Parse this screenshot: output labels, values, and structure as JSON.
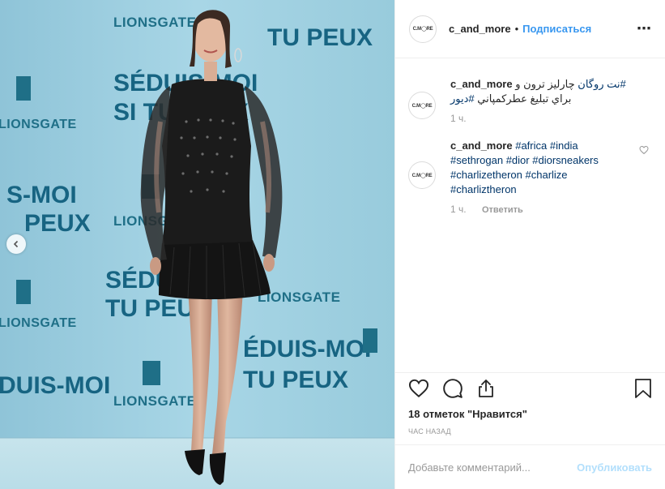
{
  "photo": {
    "wall_logos": [
      "LIONSGATE",
      "LIONSGATE",
      "LIONSGATE",
      "LIONSGATE",
      "LIONSGATE",
      "LIONSGATE"
    ],
    "wall_slogans": [
      "SÉDUIS-MOI",
      "SI TU PEUX",
      "TU PEUX",
      "S-MOI",
      "PEUX",
      "SÉDUIS-",
      "TU PEUX",
      "ÉDUIS-MOI",
      "TU PEUX",
      "DUIS-MOI"
    ],
    "colors": {
      "wall": "#9ecfe0",
      "print": "#176482",
      "dress": "#141414"
    }
  },
  "header": {
    "avatar_text": "C.M◯RE",
    "username": "c_and_more",
    "separator": "•",
    "follow_label": "Подписаться",
    "more_icon": "⋯"
  },
  "comments": [
    {
      "username": "c_and_more",
      "text_line1": "چارلیز ترون و ",
      "tag1": "#نت روگان",
      "text_line2": "براي تبليغ عطركمپاني ",
      "tag2": "#ديور",
      "time": "1 ч."
    },
    {
      "username": "c_and_more",
      "tags": [
        "#africa",
        "#india",
        "#sethrogan",
        "#dior",
        "#diorsneakers",
        "#charlizetheron",
        "#charlize",
        "#charliztheron"
      ],
      "time": "1 ч.",
      "reply_label": "Ответить"
    }
  ],
  "actions": {
    "likes_text": "18 отметок \"Нравится\"",
    "time_ago": "ЧАС НАЗАД"
  },
  "add_comment": {
    "placeholder": "Добавьте комментарий...",
    "publish_label": "Опубликовать"
  }
}
